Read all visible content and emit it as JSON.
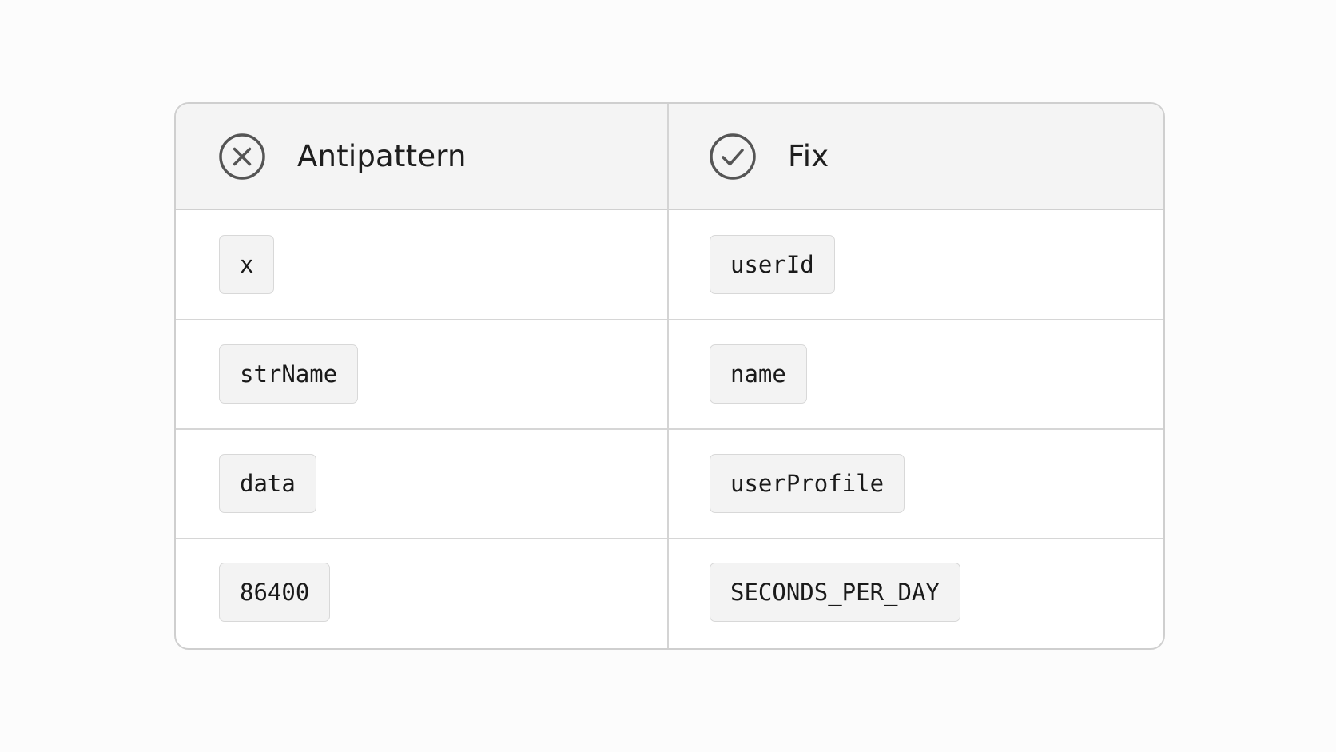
{
  "table": {
    "headers": {
      "antipattern": "Antipattern",
      "fix": "Fix"
    },
    "rows": [
      {
        "antipattern": "x",
        "fix": "userId"
      },
      {
        "antipattern": "strName",
        "fix": "name"
      },
      {
        "antipattern": "data",
        "fix": "userProfile"
      },
      {
        "antipattern": "86400",
        "fix": "SECONDS_PER_DAY"
      }
    ]
  },
  "icons": {
    "antipattern": "x-circle-icon",
    "fix": "check-circle-icon"
  },
  "colors": {
    "background": "#fcfcfc",
    "header_background": "#f4f4f4",
    "border": "#cfcfcf",
    "chip_background": "#f3f3f3",
    "icon_stroke": "#555555",
    "text": "#1e1e1e"
  }
}
